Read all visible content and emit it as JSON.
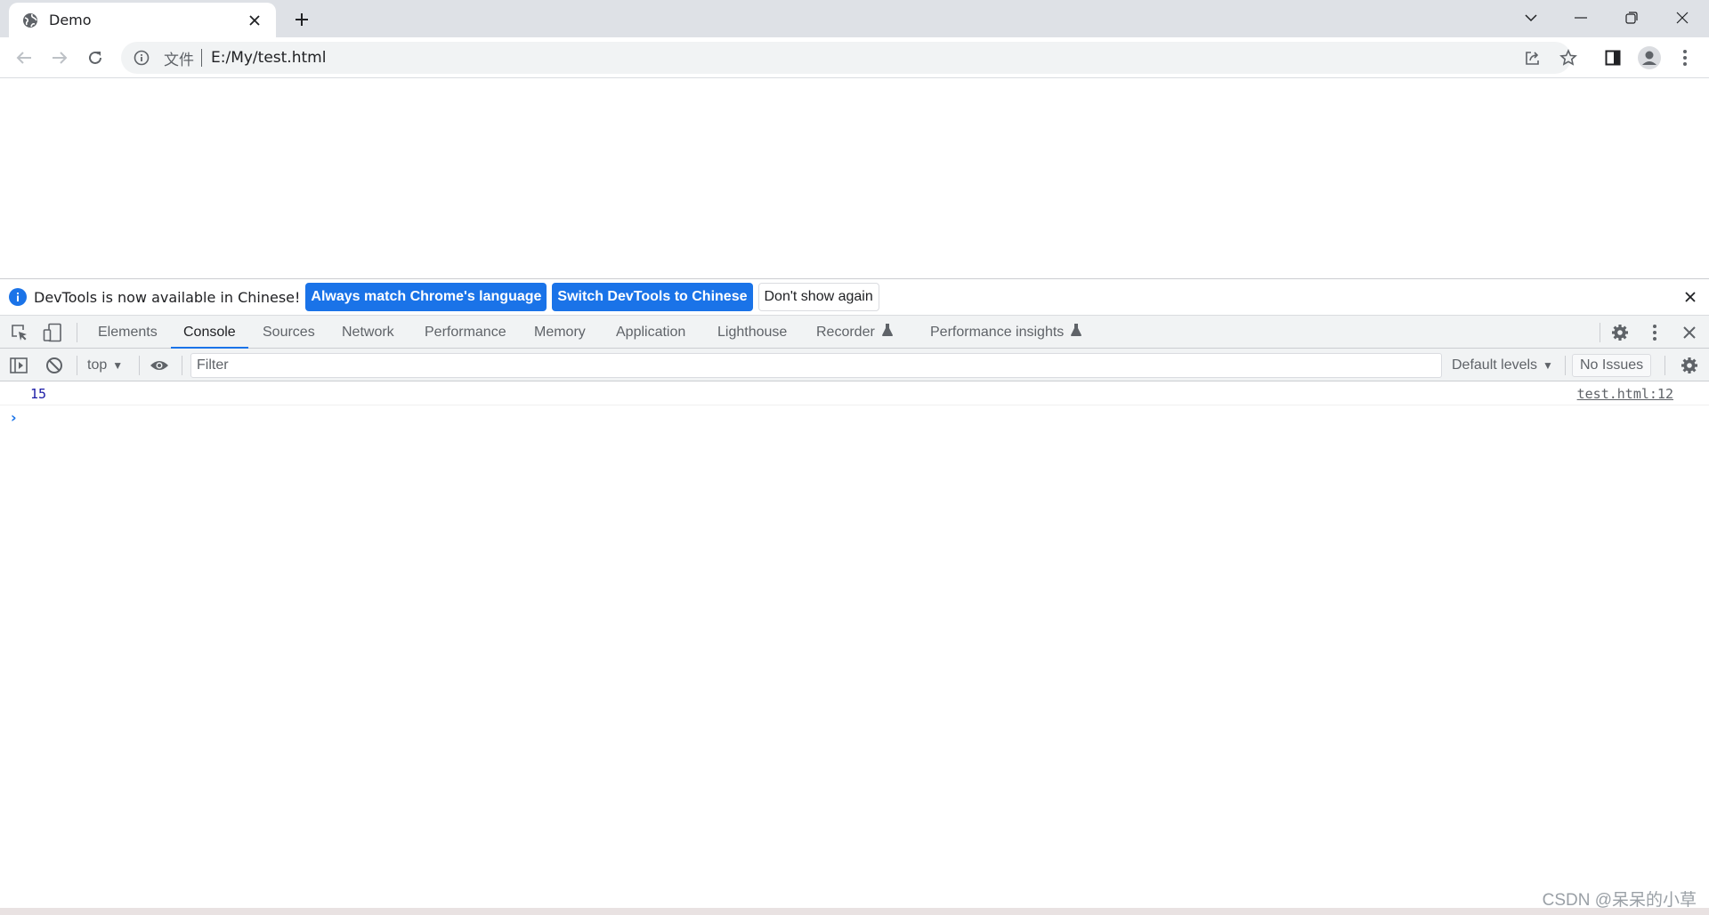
{
  "browser": {
    "tab": {
      "title": "Demo"
    },
    "omnibox": {
      "scheme_label": "文件",
      "url": "E:/My/test.html"
    }
  },
  "devtools": {
    "infobar": {
      "message": "DevTools is now available in Chinese!",
      "btn_match": "Always match Chrome's language",
      "btn_switch": "Switch DevTools to Chinese",
      "btn_dismiss": "Don't show again"
    },
    "tabs": [
      {
        "label": "Elements"
      },
      {
        "label": "Console",
        "active": true
      },
      {
        "label": "Sources"
      },
      {
        "label": "Network"
      },
      {
        "label": "Performance"
      },
      {
        "label": "Memory"
      },
      {
        "label": "Application"
      },
      {
        "label": "Lighthouse"
      },
      {
        "label": "Recorder",
        "experimental": true
      },
      {
        "label": "Performance insights",
        "experimental": true
      }
    ],
    "console_toolbar": {
      "context": "top",
      "filter_placeholder": "Filter",
      "levels": "Default levels",
      "issues": "No Issues"
    },
    "messages": [
      {
        "value": "15",
        "source": "test.html:12"
      }
    ]
  },
  "watermark": "CSDN @呆呆的小草",
  "colors": {
    "accent": "#1a73e8",
    "tabstrip": "#dee1e6",
    "panel": "#f1f3f4"
  }
}
